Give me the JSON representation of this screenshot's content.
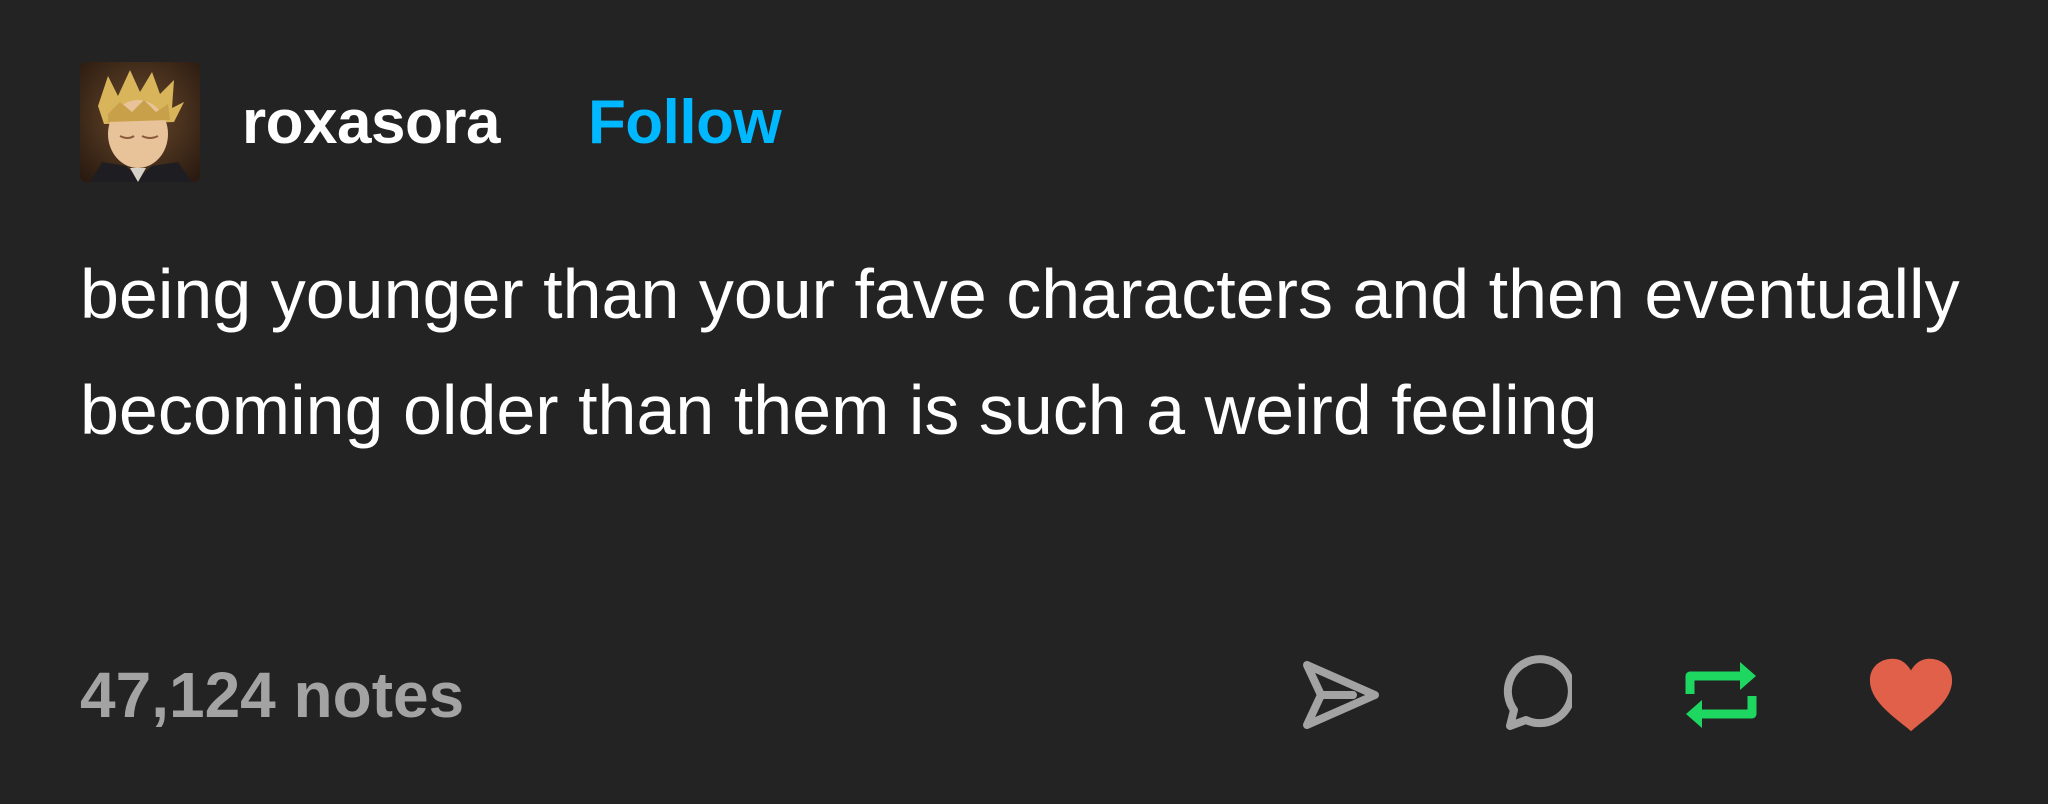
{
  "post": {
    "username": "roxasora",
    "follow_label": "Follow",
    "body": "being younger than your fave characters and then eventually becoming older than them is such a weird feeling",
    "notes_text": "47,124 notes"
  },
  "icons": {
    "avatar": "avatar-image",
    "share": "share-icon",
    "reply": "reply-icon",
    "reblog": "reblog-icon",
    "like": "heart-icon"
  },
  "colors": {
    "background": "#232323",
    "follow": "#00b8ff",
    "notes": "#a3a3a3",
    "reblog": "#1ed760",
    "like": "#e0604a"
  }
}
